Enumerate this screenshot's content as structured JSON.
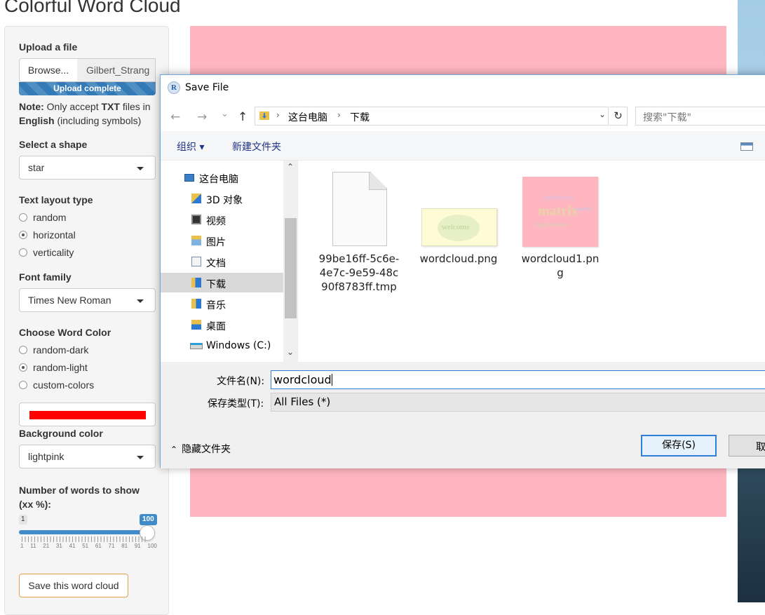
{
  "app": {
    "title": "Colorful Word Cloud",
    "upload": {
      "label": "Upload a file",
      "browse_label": "Browse...",
      "file_name": "Gilbert_Strang",
      "progress_text": "Upload complete",
      "progress_value": 1.0,
      "note_bold": "Note:",
      "note_text1": "Only accept",
      "note_bold2": "TXT",
      "note_text2": "files in",
      "note_bold3": "English",
      "note_text3": "(including symbols)"
    },
    "shape": {
      "label": "Select a shape",
      "value": "star"
    },
    "layout": {
      "label": "Text layout type",
      "options": [
        "random",
        "horizontal",
        "verticality"
      ],
      "selected": "horizontal"
    },
    "font": {
      "label": "Font family",
      "value": "Times New Roman"
    },
    "word_color": {
      "label": "Choose Word Color",
      "options": [
        "random-dark",
        "random-light",
        "custom-colors"
      ],
      "selected": "random-light",
      "custom_color": "#ff0000"
    },
    "background": {
      "label": "Background color",
      "value": "lightpink"
    },
    "slider": {
      "label": "Number of words to show (xx %):",
      "min": "1",
      "max": "100",
      "value": 100,
      "ticks": [
        "1",
        "11",
        "21",
        "31",
        "41",
        "51",
        "61",
        "71",
        "81",
        "91",
        "100"
      ]
    },
    "save_button": "Save this word cloud",
    "plot_background": "#ffb6c1"
  },
  "dialog": {
    "title": "Save File",
    "title_icon_letter": "R",
    "nav": {
      "back": "←",
      "forward": "→",
      "recent": "⌄",
      "up": "↑",
      "refresh": "↻"
    },
    "address": [
      "这台电脑",
      "下载"
    ],
    "search_placeholder": "搜索\"下载\"",
    "toolbar": {
      "organize": "组织 ▾",
      "new_folder": "新建文件夹"
    },
    "nav_items": [
      {
        "label": "这台电脑",
        "icon": "computer-icon"
      },
      {
        "label": "3D 对象",
        "icon": "3d-objects-icon"
      },
      {
        "label": "视频",
        "icon": "videos-icon"
      },
      {
        "label": "图片",
        "icon": "pictures-icon"
      },
      {
        "label": "文档",
        "icon": "documents-icon"
      },
      {
        "label": "下载",
        "icon": "downloads-icon",
        "selected": true
      },
      {
        "label": "音乐",
        "icon": "music-icon"
      },
      {
        "label": "桌面",
        "icon": "desktop-icon"
      },
      {
        "label": "Windows (C:)",
        "icon": "drive-icon"
      }
    ],
    "files": [
      {
        "name": "99be16ff-5c6e-4e7c-9e59-48c90f8783ff.tmp",
        "type": "tmp"
      },
      {
        "name": "wordcloud.png",
        "type": "png",
        "preview_word": "welcome"
      },
      {
        "name": "wordcloud1.png",
        "type": "png",
        "preview_word": "matrix"
      }
    ],
    "filename_label": "文件名(N):",
    "filename_value": "wordcloud",
    "filetype_label": "保存类型(T):",
    "filetype_value": "All Files  (*)",
    "hide_folders": "隐藏文件夹",
    "save_label": "保存(S)",
    "cancel_label": "取"
  }
}
